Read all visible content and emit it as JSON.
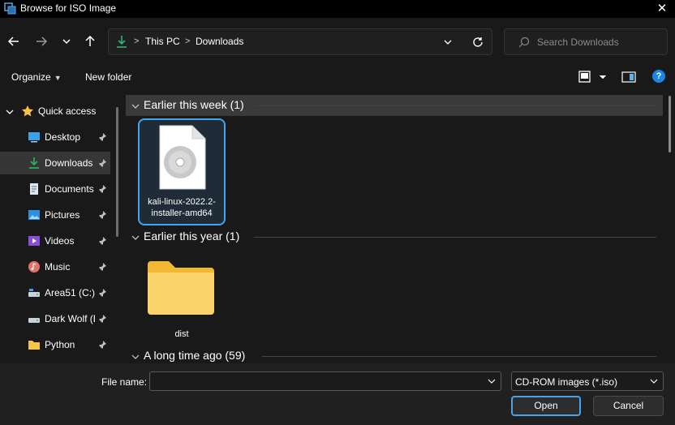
{
  "window": {
    "title": "Browse for ISO Image",
    "close_glyph": "✕"
  },
  "address": {
    "crumbs": [
      "This PC",
      "Downloads"
    ],
    "separator": ">"
  },
  "search": {
    "placeholder": "Search Downloads"
  },
  "toolbar": {
    "organize_label": "Organize",
    "new_folder_label": "New folder",
    "help_glyph": "?"
  },
  "sidebar": {
    "quick_access_label": "Quick access",
    "items": [
      {
        "label": "Desktop",
        "icon": "desktop-icon",
        "pinned": true
      },
      {
        "label": "Downloads",
        "icon": "download-icon",
        "pinned": true,
        "active": true
      },
      {
        "label": "Documents",
        "icon": "documents-icon",
        "pinned": true
      },
      {
        "label": "Pictures",
        "icon": "pictures-icon",
        "pinned": true
      },
      {
        "label": "Videos",
        "icon": "videos-icon",
        "pinned": true
      },
      {
        "label": "Music",
        "icon": "music-icon",
        "pinned": true
      },
      {
        "label": "Area51 (C:)",
        "icon": "drive-icon",
        "pinned": true
      },
      {
        "label": "Dark Wolf (D",
        "icon": "drive-icon",
        "pinned": true
      },
      {
        "label": "Python",
        "icon": "folder-icon",
        "pinned": true
      }
    ]
  },
  "groups": [
    {
      "title": "Earlier this week (1)",
      "files": [
        {
          "name_line1": "kali-linux-2022.2-",
          "name_line2": "installer-amd64",
          "icon": "disc-image-icon",
          "selected": true
        }
      ]
    },
    {
      "title": "Earlier this year (1)",
      "files": [
        {
          "name": "dist",
          "icon": "folder-icon"
        }
      ]
    },
    {
      "title": "A long time ago (59)",
      "files": []
    }
  ],
  "footer": {
    "file_name_label": "File name:",
    "file_name_value": "",
    "filter_value": "CD-ROM images (*.iso)",
    "open_label": "Open",
    "cancel_label": "Cancel"
  },
  "colors": {
    "accent": "#4ca2e6",
    "background": "#191919",
    "folder": "#f5c24a"
  }
}
